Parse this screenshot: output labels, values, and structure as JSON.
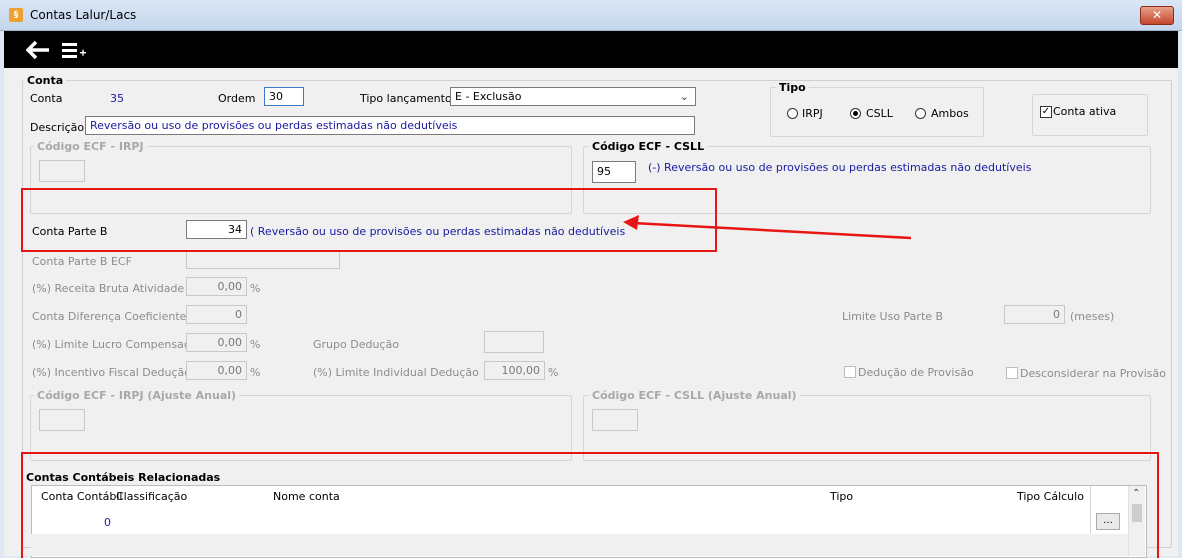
{
  "window": {
    "title": "Contas Lalur/Lacs",
    "app_icon": "app-icon",
    "close_icon": "close-icon"
  },
  "toolbar": {
    "back_icon": "arrow-left-icon",
    "menu_icon": "list-add-icon"
  },
  "conta": {
    "group_title": "Conta",
    "conta_label": "Conta",
    "conta_value": "35",
    "ordem_label": "Ordem",
    "ordem_value": "30",
    "tipo_lancamento_label": "Tipo lançamento",
    "tipo_lancamento_value": "E - Exclusão",
    "descricao_label": "Descrição",
    "descricao_value": "Reversão ou uso de provisões ou perdas estimadas não dedutíveis"
  },
  "tipo": {
    "group_title": "Tipo",
    "options": [
      "IRPJ",
      "CSLL",
      "Ambos"
    ],
    "selected": "CSLL"
  },
  "conta_ativa": {
    "label": "Conta ativa",
    "checked": true
  },
  "ecf_irpj": {
    "title": "Código ECF - IRPJ",
    "value": ""
  },
  "ecf_csll": {
    "title": "Código ECF - CSLL",
    "value": "95",
    "desc": "(-) Reversão ou uso de provisões ou perdas estimadas não dedutíveis"
  },
  "parte_b": {
    "label": "Conta Parte B",
    "value": "34",
    "desc": "( Reversão ou uso de provisões ou perdas estimadas não dedutíveis"
  },
  "fields": {
    "parte_b_ecf_label": "Conta Parte B ECF",
    "receita_bruta_label": "(%) Receita Bruta Atividade",
    "receita_bruta_value": "0,00",
    "diferenca_coef_label": "Conta Diferença Coeficiente",
    "diferenca_coef_value": "0",
    "limite_lucro_label": "(%) Limite Lucro Compensação",
    "limite_lucro_value": "0,00",
    "incentivo_label": "(%) Incentivo Fiscal Dedução",
    "incentivo_value": "0,00",
    "grupo_deducao_label": "Grupo Dedução",
    "limite_individual_label": "(%) Limite Individual Dedução",
    "limite_individual_value": "100,00",
    "percent": "%",
    "limite_uso_label": "Limite Uso Parte B",
    "limite_uso_value": "0",
    "meses": "(meses)",
    "deducao_provisao_label": "Dedução de Provisão",
    "desconsiderar_label": "Desconsiderar na Provisão"
  },
  "ecf_irpj_anual": {
    "title": "Código ECF - IRPJ (Ajuste Anual)"
  },
  "ecf_csll_anual": {
    "title": "Código ECF - CSLL (Ajuste Anual)"
  },
  "contas_relacionadas": {
    "title": "Contas Contábeis Relacionadas",
    "columns": [
      "Conta Contábil",
      "Classificação",
      "Nome conta",
      "Tipo",
      "Tipo Cálculo"
    ],
    "rows": [
      {
        "conta": "0"
      }
    ],
    "button_label": "..."
  },
  "colors": {
    "highlight": "#e81515",
    "link_blue": "#1a1aa0"
  }
}
